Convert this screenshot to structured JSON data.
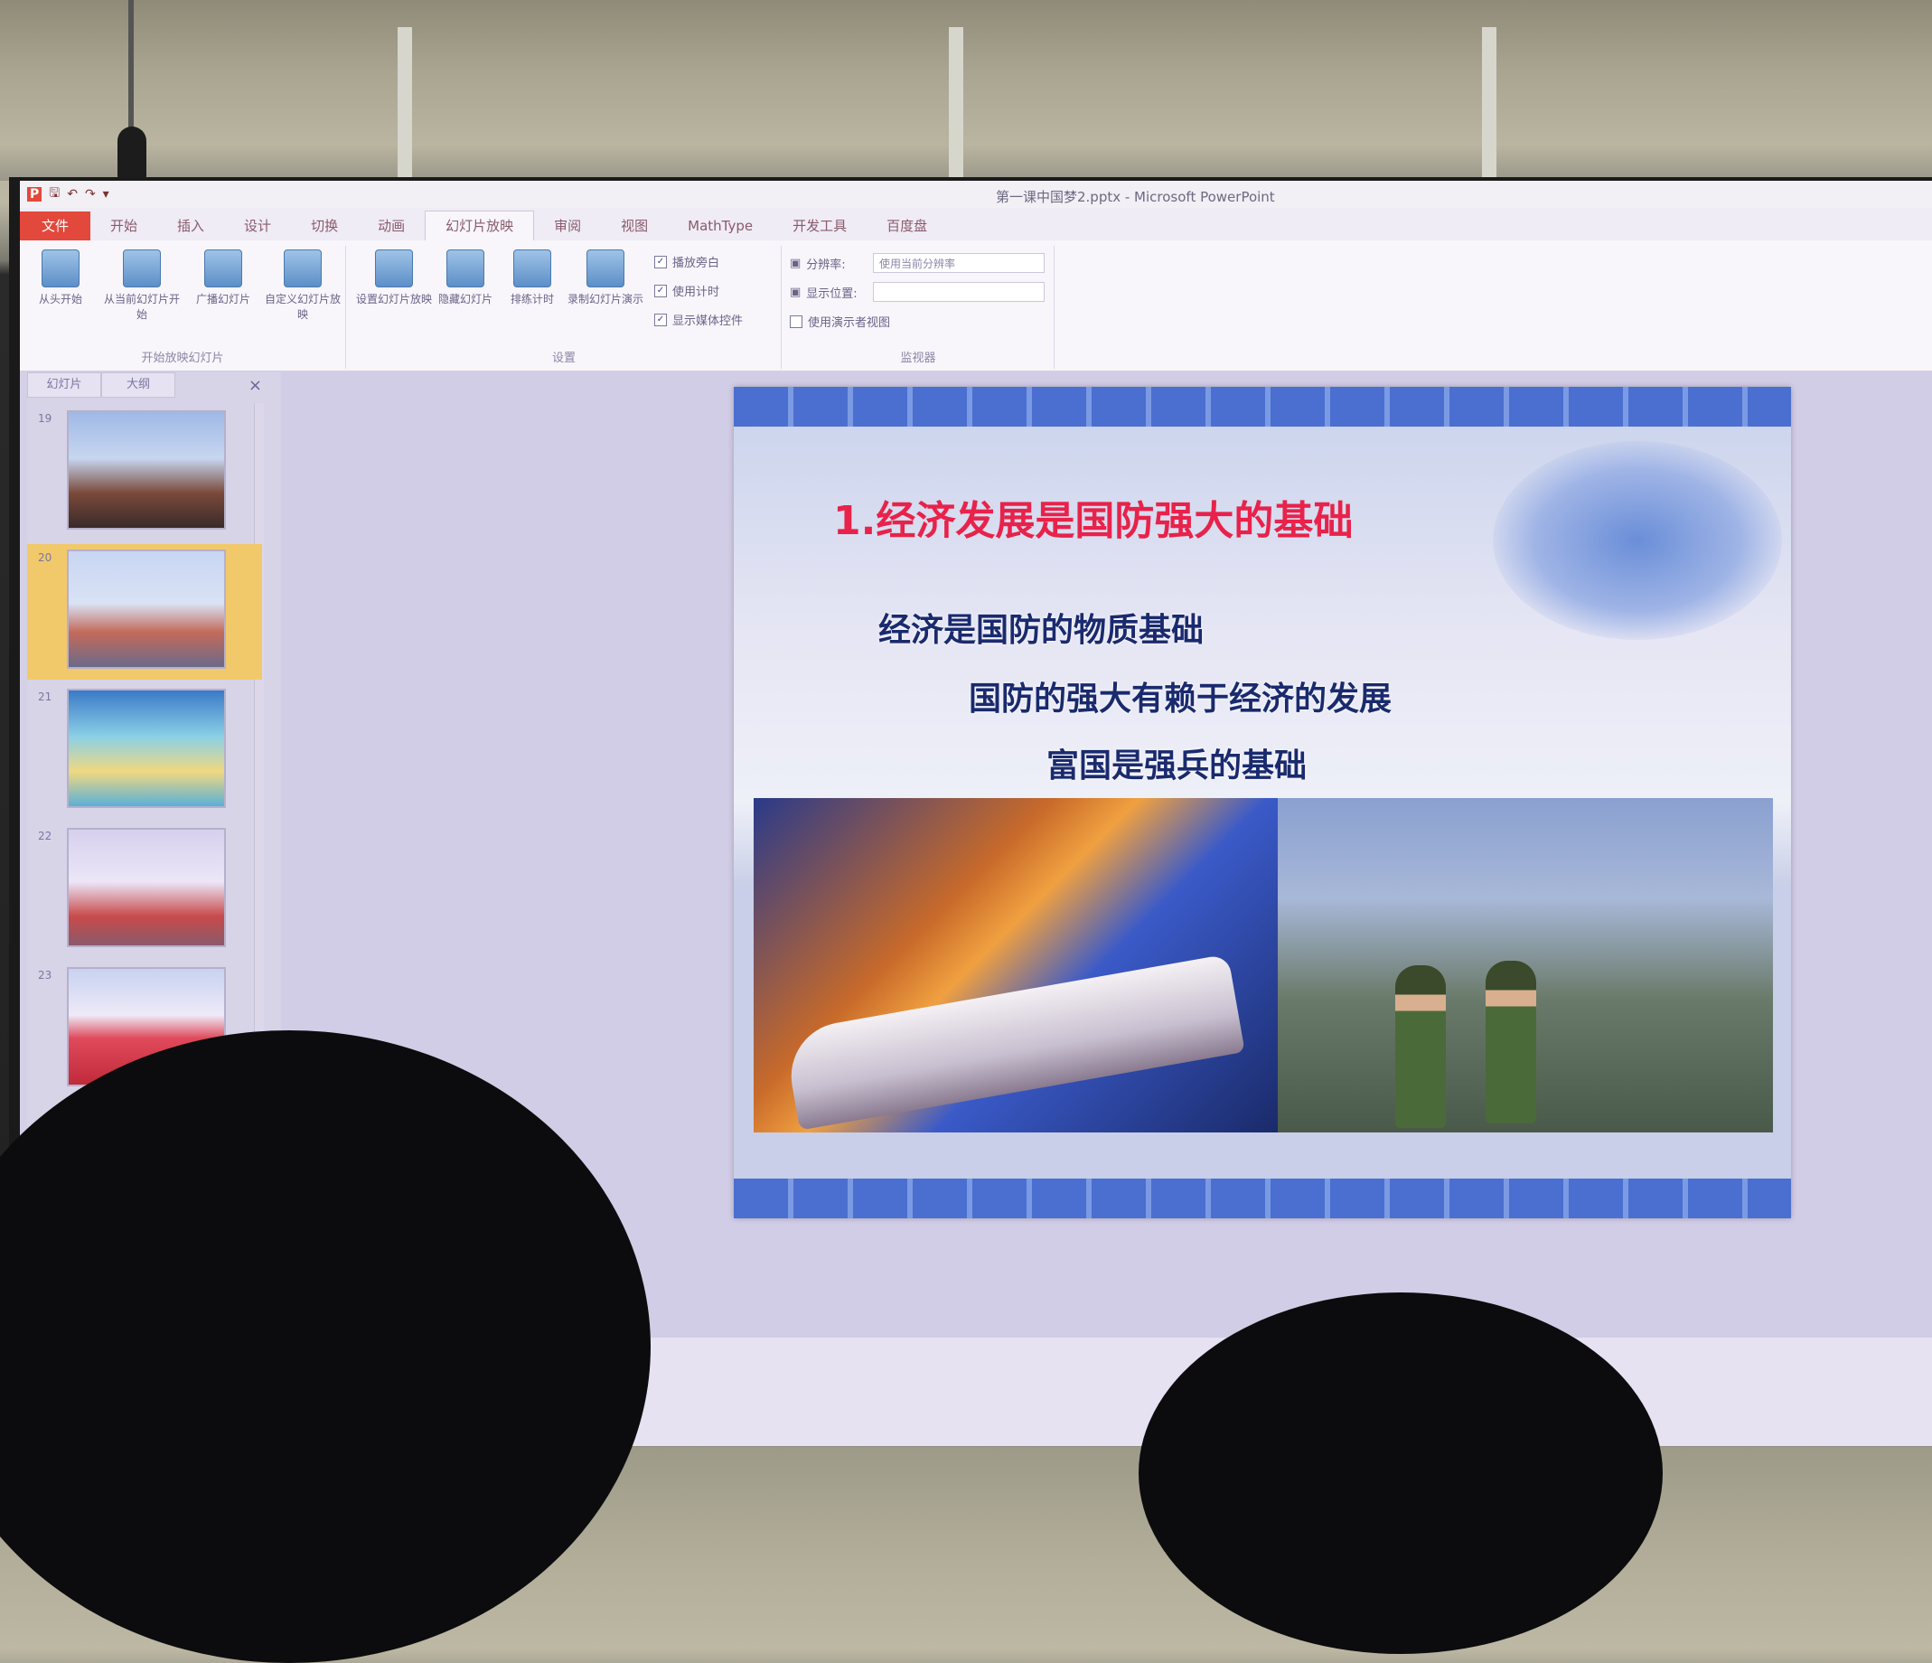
{
  "window": {
    "title": "第一课中国梦2.pptx - Microsoft PowerPoint",
    "quick_access": [
      "保存",
      "撤销",
      "重复"
    ]
  },
  "ribbon_tabs": [
    "文件",
    "开始",
    "插入",
    "设计",
    "切换",
    "动画",
    "幻灯片放映",
    "审阅",
    "视图",
    "MathType",
    "开发工具",
    "百度盘"
  ],
  "ribbon_active_tab": "幻灯片放映",
  "ribbon": {
    "group_start": {
      "label": "开始放映幻灯片",
      "buttons": [
        "从头开始",
        "从当前幻灯片开始",
        "广播幻灯片",
        "自定义幻灯片放映"
      ]
    },
    "group_setup": {
      "label": "设置",
      "buttons": [
        "设置幻灯片放映",
        "隐藏幻灯片",
        "排练计时",
        "录制幻灯片演示"
      ],
      "checkboxes": [
        {
          "label": "播放旁白",
          "checked": true
        },
        {
          "label": "使用计时",
          "checked": true
        },
        {
          "label": "显示媒体控件",
          "checked": true
        }
      ]
    },
    "group_monitors": {
      "label": "监视器",
      "resolution_label": "分辨率:",
      "resolution_value": "使用当前分辨率",
      "show_on_label": "显示位置:",
      "show_on_value": "",
      "presenter_view": {
        "label": "使用演示者视图",
        "checked": false
      }
    }
  },
  "left_pane": {
    "tabs": [
      "幻灯片",
      "大纲"
    ],
    "close": "×",
    "thumbnails": [
      {
        "num": "19",
        "active": false
      },
      {
        "num": "20",
        "active": true
      },
      {
        "num": "21",
        "active": false
      },
      {
        "num": "22",
        "active": false
      },
      {
        "num": "23",
        "active": false
      }
    ]
  },
  "slide": {
    "title": "1.经济发展是国防强大的基础",
    "lines": [
      "经济是国防的物质基础",
      "国防的强大有赖于经济的发展",
      "富国是强兵的基础"
    ]
  },
  "colors": {
    "file_tab": "#e2483b",
    "slide_title": "#e8224a",
    "slide_text": "#1a2a6e",
    "active_thumb": "#f2c96a"
  }
}
